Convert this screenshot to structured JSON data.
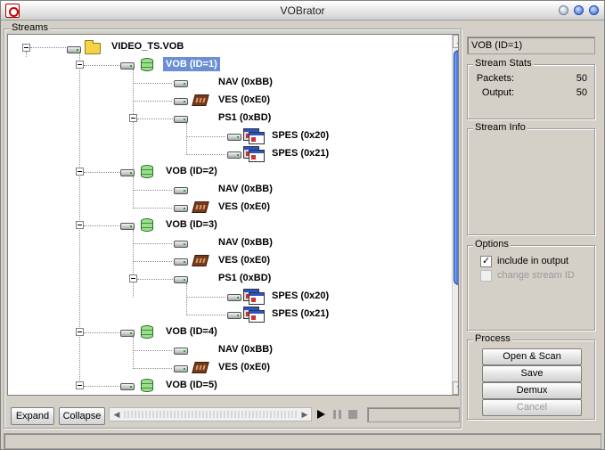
{
  "window": {
    "title": "VOBrator"
  },
  "streams": {
    "label": "Streams",
    "tree": {
      "root": "VIDEO_TS.VOB",
      "vob1": "VOB (ID=1)",
      "vob1_nav": "NAV (0xBB)",
      "vob1_ves": "VES (0xE0)",
      "vob1_ps1": "PS1 (0xBD)",
      "vob1_spes20": "SPES (0x20)",
      "vob1_spes21": "SPES (0x21)",
      "vob2": "VOB (ID=2)",
      "vob2_nav": "NAV (0xBB)",
      "vob2_ves": "VES (0xE0)",
      "vob3": "VOB (ID=3)",
      "vob3_nav": "NAV (0xBB)",
      "vob3_ves": "VES (0xE0)",
      "vob3_ps1": "PS1 (0xBD)",
      "vob3_spes20": "SPES (0x20)",
      "vob3_spes21": "SPES (0x21)",
      "vob4": "VOB (ID=4)",
      "vob4_nav": "NAV (0xBB)",
      "vob4_ves": "VES (0xE0)",
      "vob5": "VOB (ID=5)"
    },
    "expand_label": "Expand",
    "collapse_label": "Collapse"
  },
  "selected_stream": "VOB (ID=1)",
  "stream_stats": {
    "label": "Stream Stats",
    "packets_label": "Packets:",
    "packets_value": "50",
    "output_label": "Output:",
    "output_value": "50"
  },
  "stream_info": {
    "label": "Stream Info"
  },
  "options": {
    "label": "Options",
    "include_label": "include in output",
    "include_checked": true,
    "change_id_label": "change stream ID",
    "change_id_checked": false
  },
  "process": {
    "label": "Process",
    "open_scan_label": "Open & Scan",
    "save_label": "Save",
    "demux_label": "Demux",
    "cancel_label": "Cancel"
  },
  "progress_fraction": 0,
  "icons": {
    "app": "vobrator-app-icon",
    "minimize": "minimize-icon",
    "maximize": "maximize-icon",
    "close": "close-icon",
    "play": "play-icon",
    "pause": "pause-icon",
    "stop": "stop-icon"
  }
}
